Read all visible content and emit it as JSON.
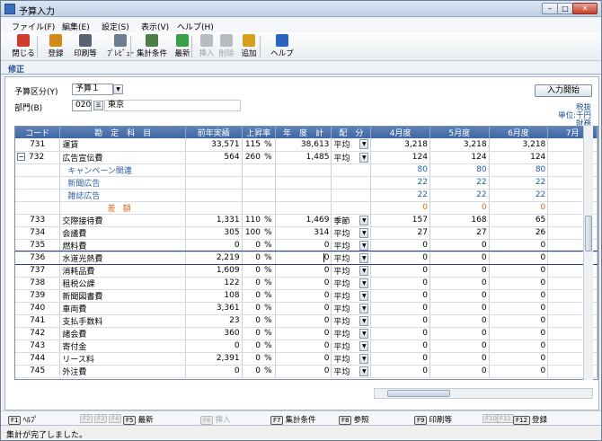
{
  "window": {
    "title": "予算入力"
  },
  "menu": [
    "ファイル(F)",
    "編集(E)",
    "設定(S)",
    "表示(V)",
    "ヘルプ(H)"
  ],
  "toolbar": [
    {
      "label": "閉じる",
      "icon": "close-icon",
      "color": "#d23a2b",
      "enabled": true
    },
    {
      "label": "登録",
      "icon": "register-icon",
      "color": "#d08a1a",
      "enabled": true
    },
    {
      "label": "印刷等",
      "icon": "printer-icon",
      "color": "#5a6470",
      "enabled": true
    },
    {
      "label": "ﾌﾟﾚﾋﾞｭｰ",
      "icon": "preview-icon",
      "color": "#6d7d92",
      "enabled": true
    },
    {
      "label": "集計条件",
      "icon": "aggregate-icon",
      "color": "#4d7d4a",
      "enabled": true
    },
    {
      "label": "最新",
      "icon": "refresh-icon",
      "color": "#3aa046",
      "enabled": true
    },
    {
      "label": "挿入",
      "icon": "insert-row-icon",
      "color": "#b7bcc4",
      "enabled": false
    },
    {
      "label": "削除",
      "icon": "delete-row-icon",
      "color": "#b7bcc4",
      "enabled": false
    },
    {
      "label": "追加",
      "icon": "add-row-icon",
      "color": "#d6a11d",
      "enabled": true
    },
    {
      "label": "ヘルプ",
      "icon": "help-icon",
      "color": "#2a63c2",
      "enabled": true
    }
  ],
  "tab": "修正",
  "filters": {
    "budget_type_label": "予算区分(Y)",
    "budget_type_value": "予算１",
    "dept_label": "部門(B)",
    "dept_code": "020",
    "dept_name": "東京"
  },
  "start_button": "入力開始",
  "units": {
    "tax": "税抜",
    "unit": "単位:千円",
    "category": "財務"
  },
  "columns": [
    "コード",
    "勘　定　科　目",
    "前年実績",
    "上昇率",
    "年　度　計",
    "配　分",
    "4月度",
    "5月度",
    "6月度",
    "7月"
  ],
  "rows": [
    {
      "code": "731",
      "name": "運賃",
      "prev": "33,571",
      "rate": "115",
      "pct": "%",
      "total": "38,613",
      "alloc": "平均",
      "m4": "3,218",
      "m5": "3,218",
      "m6": "3,218",
      "type": "normal"
    },
    {
      "code": "732",
      "name": "広告宣伝費",
      "prev": "564",
      "rate": "260",
      "pct": "%",
      "total": "1,485",
      "alloc": "平均",
      "m4": "124",
      "m5": "124",
      "m6": "124",
      "type": "group"
    },
    {
      "code": "",
      "name": "キャンペーン関連",
      "prev": "",
      "rate": "",
      "pct": "",
      "total": "",
      "alloc": "",
      "m4": "80",
      "m5": "80",
      "m6": "80",
      "type": "sub"
    },
    {
      "code": "",
      "name": "新聞広告",
      "prev": "",
      "rate": "",
      "pct": "",
      "total": "",
      "alloc": "",
      "m4": "22",
      "m5": "22",
      "m6": "22",
      "type": "sub"
    },
    {
      "code": "",
      "name": "雑誌広告",
      "prev": "",
      "rate": "",
      "pct": "",
      "total": "",
      "alloc": "",
      "m4": "22",
      "m5": "22",
      "m6": "22",
      "type": "sub"
    },
    {
      "code": "",
      "name": "差額",
      "prev": "",
      "rate": "",
      "pct": "",
      "total": "",
      "alloc": "",
      "m4": "0",
      "m5": "0",
      "m6": "0",
      "type": "diff"
    },
    {
      "code": "733",
      "name": "交際接待費",
      "prev": "1,331",
      "rate": "110",
      "pct": "%",
      "total": "1,469",
      "alloc": "季節",
      "m4": "157",
      "m5": "168",
      "m6": "65",
      "type": "normal"
    },
    {
      "code": "734",
      "name": "会議費",
      "prev": "305",
      "rate": "100",
      "pct": "%",
      "total": "314",
      "alloc": "平均",
      "m4": "27",
      "m5": "27",
      "m6": "26",
      "type": "normal"
    },
    {
      "code": "735",
      "name": "燃料費",
      "prev": "0",
      "rate": "0",
      "pct": "%",
      "total": "0",
      "alloc": "平均",
      "m4": "0",
      "m5": "0",
      "m6": "0",
      "type": "normal"
    },
    {
      "code": "736",
      "name": "水道光熱費",
      "prev": "2,219",
      "rate": "0",
      "pct": "%",
      "total": "0",
      "alloc": "平均",
      "m4": "0",
      "m5": "0",
      "m6": "0",
      "type": "sel"
    },
    {
      "code": "737",
      "name": "消耗品費",
      "prev": "1,609",
      "rate": "0",
      "pct": "%",
      "total": "0",
      "alloc": "平均",
      "m4": "0",
      "m5": "0",
      "m6": "0",
      "type": "normal"
    },
    {
      "code": "738",
      "name": "租税公課",
      "prev": "122",
      "rate": "0",
      "pct": "%",
      "total": "0",
      "alloc": "平均",
      "m4": "0",
      "m5": "0",
      "m6": "0",
      "type": "normal"
    },
    {
      "code": "739",
      "name": "新聞図書費",
      "prev": "108",
      "rate": "0",
      "pct": "%",
      "total": "0",
      "alloc": "平均",
      "m4": "0",
      "m5": "0",
      "m6": "0",
      "type": "normal"
    },
    {
      "code": "740",
      "name": "車両費",
      "prev": "3,361",
      "rate": "0",
      "pct": "%",
      "total": "0",
      "alloc": "平均",
      "m4": "0",
      "m5": "0",
      "m6": "0",
      "type": "normal"
    },
    {
      "code": "741",
      "name": "支払手数料",
      "prev": "23",
      "rate": "0",
      "pct": "%",
      "total": "0",
      "alloc": "平均",
      "m4": "0",
      "m5": "0",
      "m6": "0",
      "type": "normal"
    },
    {
      "code": "742",
      "name": "諸会費",
      "prev": "360",
      "rate": "0",
      "pct": "%",
      "total": "0",
      "alloc": "平均",
      "m4": "0",
      "m5": "0",
      "m6": "0",
      "type": "normal"
    },
    {
      "code": "743",
      "name": "寄付金",
      "prev": "0",
      "rate": "0",
      "pct": "%",
      "total": "0",
      "alloc": "平均",
      "m4": "0",
      "m5": "0",
      "m6": "0",
      "type": "normal"
    },
    {
      "code": "744",
      "name": "リース料",
      "prev": "2,391",
      "rate": "0",
      "pct": "%",
      "total": "0",
      "alloc": "平均",
      "m4": "0",
      "m5": "0",
      "m6": "0",
      "type": "normal"
    },
    {
      "code": "745",
      "name": "外注費",
      "prev": "0",
      "rate": "0",
      "pct": "%",
      "total": "0",
      "alloc": "平均",
      "m4": "0",
      "m5": "0",
      "m6": "0",
      "type": "normal"
    }
  ],
  "fkeys": [
    {
      "key": "F1",
      "label": "ﾍﾙﾌﾟ",
      "enabled": true
    },
    {
      "key": "F2",
      "label": "",
      "enabled": false
    },
    {
      "key": "F3",
      "label": "",
      "enabled": false
    },
    {
      "key": "F4",
      "label": "",
      "enabled": false
    },
    {
      "key": "F5",
      "label": "最新",
      "enabled": true
    },
    {
      "key": "F6",
      "label": "挿入",
      "enabled": false
    },
    {
      "key": "F7",
      "label": "集計条件",
      "enabled": true
    },
    {
      "key": "F8",
      "label": "参照",
      "enabled": true
    },
    {
      "key": "F9",
      "label": "印刷等",
      "enabled": true
    },
    {
      "key": "F10",
      "label": "",
      "enabled": false
    },
    {
      "key": "F11",
      "label": "",
      "enabled": false
    },
    {
      "key": "F12",
      "label": "登録",
      "enabled": true
    }
  ],
  "status": "集計が完了しました。"
}
